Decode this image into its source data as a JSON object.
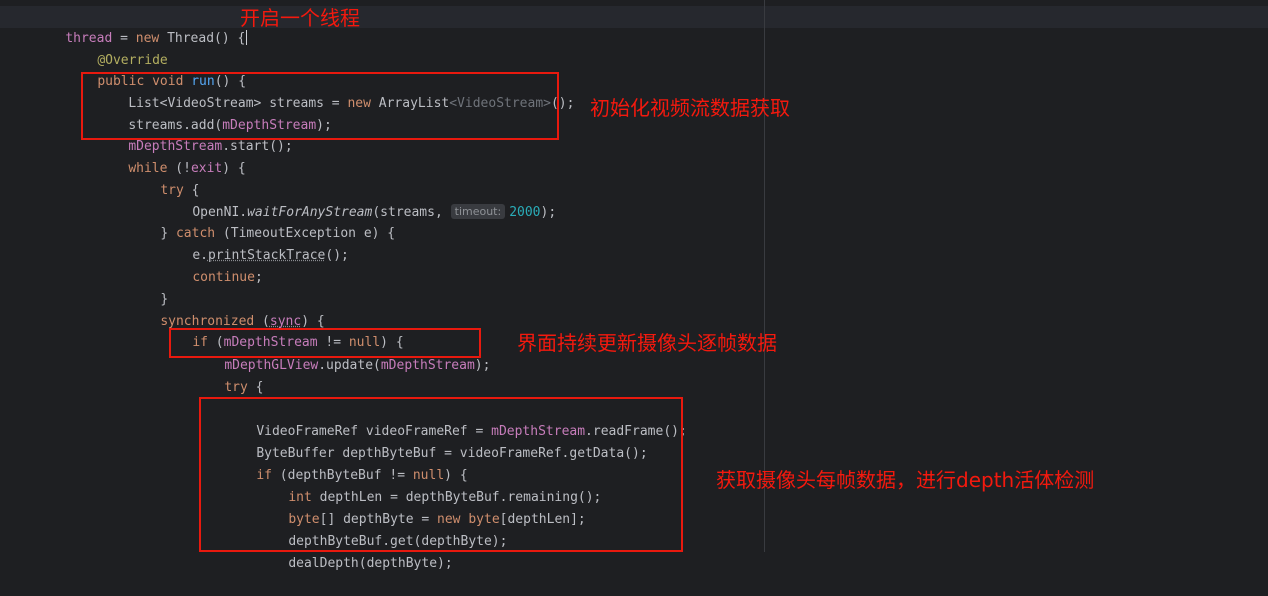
{
  "code": {
    "l1_thread": "thread",
    "l1_eq": " = ",
    "l1_new": "new",
    "l1_cls": " Thread() ",
    "l1_brace": "{",
    "l2_ann": "@Override",
    "l3_public": "public void",
    "l3_sp": " ",
    "l3_run": "run",
    "l3_rest": "() {",
    "l4_list": "List<VideoStream> streams = ",
    "l4_new": "new",
    "l4_arr": " ArrayList",
    "l4_gen": "<VideoStream>",
    "l4_end": "();",
    "l5_a": "streams.add(",
    "l5_fld": "mDepthStream",
    "l5_b": ");",
    "l6_fld": "mDepthStream",
    "l6_b": ".start();",
    "l7_while": "while",
    "l7_rest": " (!",
    "l7_exit": "exit",
    "l7_end": ") {",
    "l8_try": "try",
    "l8_rest": " {",
    "l9_a": "OpenNI.",
    "l9_fn": "waitForAnyStream",
    "l9_b": "(streams, ",
    "l9_hint": "timeout:",
    "l9_num": "2000",
    "l9_end": ");",
    "l10_a": "} ",
    "l10_catch": "catch",
    "l10_b": " (TimeoutException e) {",
    "l11_a": "e.",
    "l11_fn": "printStackTrace",
    "l11_b": "();",
    "l12_cont": "continue",
    "l12_b": ";",
    "l13": "}",
    "l14_sync": "synchronized",
    "l14_a": " (",
    "l14_var": "sync",
    "l14_b": ") {",
    "l15_if": "if",
    "l15_a": " (",
    "l15_fld": "mDepthStream",
    "l15_b": " != ",
    "l15_null": "null",
    "l15_c": ") {",
    "l16_fld": "mDepthGLView",
    "l16_a": ".update(",
    "l16_fld2": "mDepthStream",
    "l16_b": ");",
    "l17_try": "try",
    "l17_b": " {",
    "l18_a": "VideoFrameRef videoFrameRef = ",
    "l18_fld": "mDepthStream",
    "l18_b": ".readFrame();",
    "l19": "ByteBuffer depthByteBuf = videoFrameRef.getData();",
    "l20_if": "if",
    "l20_a": " (depthByteBuf != ",
    "l20_null": "null",
    "l20_b": ") {",
    "l21_int": "int",
    "l21_a": " depthLen = depthByteBuf.remaining();",
    "l22_byte": "byte",
    "l22_a": "[] depthByte = ",
    "l22_new": "new",
    "l22_sp": " ",
    "l22_byte2": "byte",
    "l22_b": "[depthLen];",
    "l23": "depthByteBuf.get(depthByte);",
    "l24": "dealDepth(depthByte);"
  },
  "annotations": {
    "note1": "开启一个线程",
    "note2": "初始化视频流数据获取",
    "note3": "界面持续更新摄像头逐帧数据",
    "note4": "获取摄像头每帧数据，进行depth活体检测"
  },
  "colors": {
    "background": "#1e1f22",
    "keyword": "#cf8e6d",
    "field": "#c77dbb",
    "function": "#56a8f5",
    "number": "#2aacb8",
    "annotation": "#b3ae60",
    "highlight_box": "#e8190e"
  }
}
